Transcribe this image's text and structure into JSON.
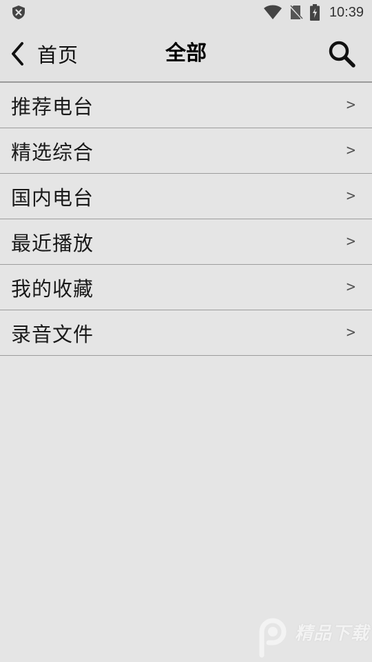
{
  "status_bar": {
    "time": "10:39",
    "left_icon": "shield-x-icon",
    "right_icons": [
      "wifi-icon",
      "no-sim-icon",
      "battery-charging-icon"
    ]
  },
  "header": {
    "back_label": "首页",
    "title": "全部",
    "back_icon": "chevron-left-icon",
    "search_icon": "search-icon"
  },
  "menu": {
    "items": [
      {
        "label": "推荐电台",
        "arrow": ">"
      },
      {
        "label": "精选综合",
        "arrow": ">"
      },
      {
        "label": "国内电台",
        "arrow": ">"
      },
      {
        "label": "最近播放",
        "arrow": ">"
      },
      {
        "label": "我的收藏",
        "arrow": ">"
      },
      {
        "label": "录音文件",
        "arrow": ">"
      }
    ]
  },
  "watermark": {
    "text": "精品下载"
  }
}
